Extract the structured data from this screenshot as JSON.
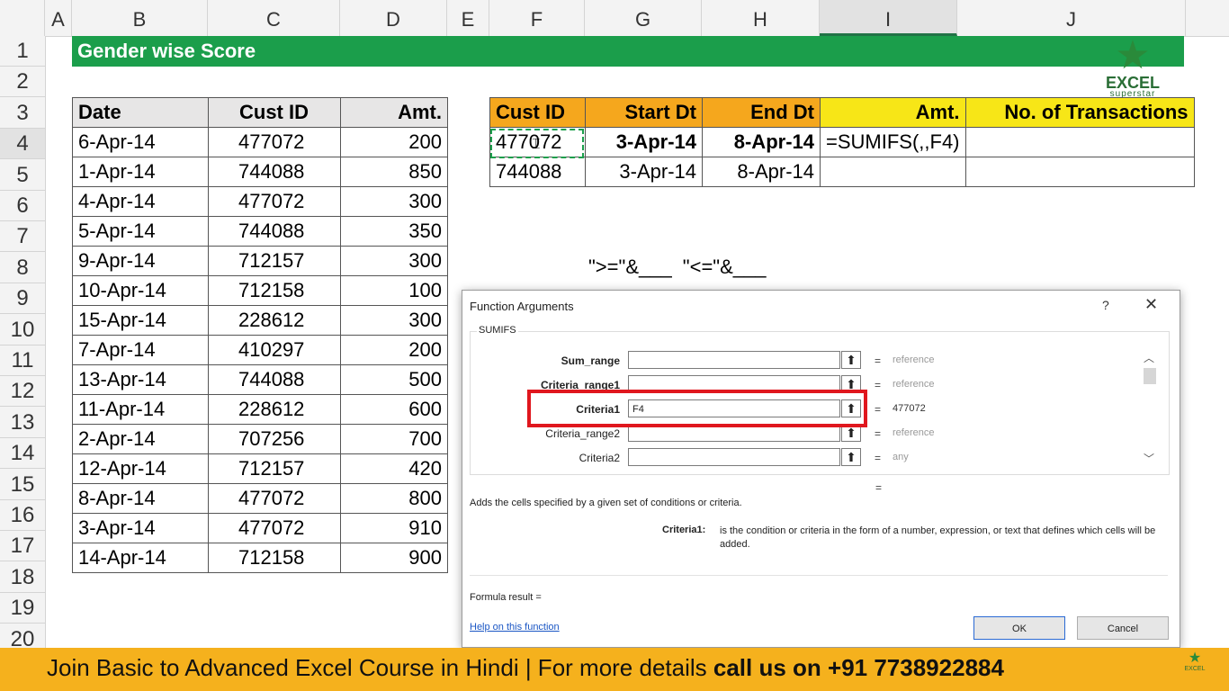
{
  "columns": [
    "A",
    "B",
    "C",
    "D",
    "E",
    "F",
    "G",
    "H",
    "I",
    "J"
  ],
  "rows": [
    "1",
    "2",
    "3",
    "4",
    "5",
    "6",
    "7",
    "8",
    "9",
    "10",
    "11",
    "12",
    "13",
    "14",
    "15",
    "16",
    "17",
    "18",
    "19",
    "20"
  ],
  "sheet_title": "Gender wise Score",
  "data_table": {
    "headers": [
      "Date",
      "Cust ID",
      "Amt."
    ],
    "rows": [
      [
        "6-Apr-14",
        "477072",
        "200"
      ],
      [
        "1-Apr-14",
        "744088",
        "850"
      ],
      [
        "4-Apr-14",
        "477072",
        "300"
      ],
      [
        "5-Apr-14",
        "744088",
        "350"
      ],
      [
        "9-Apr-14",
        "712157",
        "300"
      ],
      [
        "10-Apr-14",
        "712158",
        "100"
      ],
      [
        "15-Apr-14",
        "228612",
        "300"
      ],
      [
        "7-Apr-14",
        "410297",
        "200"
      ],
      [
        "13-Apr-14",
        "744088",
        "500"
      ],
      [
        "11-Apr-14",
        "228612",
        "600"
      ],
      [
        "2-Apr-14",
        "707256",
        "700"
      ],
      [
        "12-Apr-14",
        "712157",
        "420"
      ],
      [
        "8-Apr-14",
        "477072",
        "800"
      ],
      [
        "3-Apr-14",
        "477072",
        "910"
      ],
      [
        "14-Apr-14",
        "712158",
        "900"
      ]
    ]
  },
  "lookup_table": {
    "headers": [
      "Cust ID",
      "Start Dt",
      "End Dt",
      "Amt.",
      "No. of Transactions"
    ],
    "rows": [
      [
        "477072",
        "3-Apr-14",
        "8-Apr-14",
        "=SUMIFS(,,F4)",
        ""
      ],
      [
        "744088",
        "3-Apr-14",
        "8-Apr-14",
        "",
        ""
      ]
    ]
  },
  "hint_text": "\">=\"&___   \"<=\"&___",
  "logo": {
    "line1": "EXCEL",
    "line2": "superstar"
  },
  "dialog": {
    "title": "Function Arguments",
    "help": "?",
    "close": "✕",
    "function_name": "SUMIFS",
    "args": [
      {
        "name": "Sum_range",
        "value": "",
        "result": "reference"
      },
      {
        "name": "Criteria_range1",
        "value": "",
        "result": "reference"
      },
      {
        "name": "Criteria1",
        "value": "F4",
        "result": "477072"
      },
      {
        "name": "Criteria_range2",
        "value": "",
        "result": "reference"
      },
      {
        "name": "Criteria2",
        "value": "",
        "result": "any"
      }
    ],
    "eq_sign": "=",
    "description": "Adds the cells specified by a given set of conditions or criteria.",
    "criteria_name": "Criteria1:",
    "criteria_desc": "is the condition or criteria in the form of a number, expression, or text that defines which cells will be added.",
    "formula_result": "Formula result =",
    "help_link": "Help on this function",
    "ok": "OK",
    "cancel": "Cancel"
  },
  "banner": {
    "part1": "Join Basic to Advanced Excel Course in Hindi | For more details ",
    "part2": "call us on +91 7738922884"
  },
  "colors": {
    "title_green": "#1b9e4b",
    "header_orange": "#f5a71d",
    "header_yellow": "#f7e617",
    "banner": "#f5b11d",
    "highlight_red": "#e0171e"
  }
}
